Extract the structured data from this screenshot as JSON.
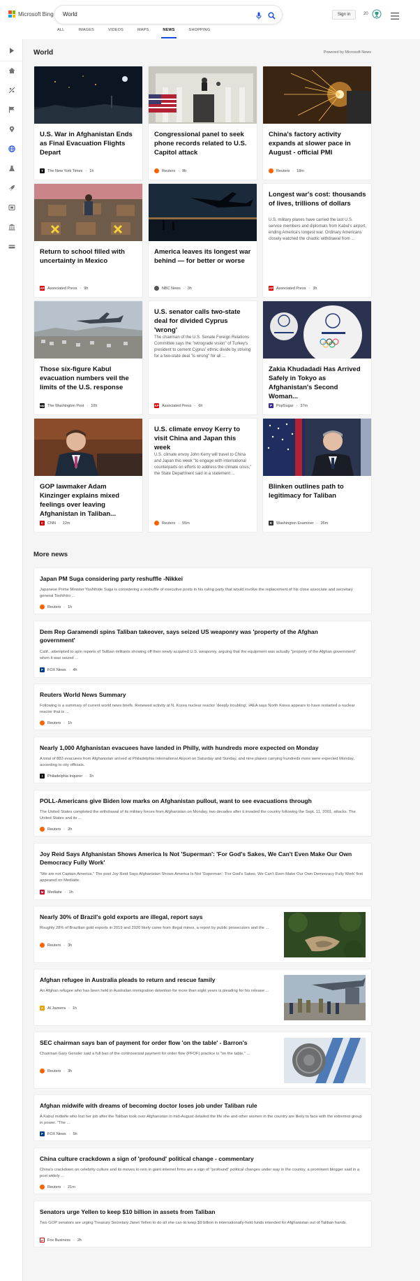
{
  "header": {
    "brand": "Microsoft Bing",
    "search_value": "World",
    "signin": "Sign in",
    "points": "20",
    "tabs": [
      {
        "label": "ALL"
      },
      {
        "label": "IMAGES"
      },
      {
        "label": "VIDEOS"
      },
      {
        "label": "MAPS"
      },
      {
        "label": "NEWS"
      },
      {
        "label": "SHOPPING"
      }
    ],
    "active_tab": "NEWS",
    "colors": {
      "accent": "#174ae4",
      "ms_red": "#f25022",
      "ms_green": "#7fba00",
      "ms_blue": "#00a4ef",
      "ms_yellow": "#ffb900"
    }
  },
  "rail": {
    "icons": [
      "expand-icon",
      "home-icon",
      "sports-icon",
      "flag-icon",
      "location-icon",
      "globe-icon",
      "science-icon",
      "rocket-icon",
      "entertainment-icon",
      "bank-icon",
      "money-icon"
    ]
  },
  "world": {
    "title": "World",
    "powered_by": "Powered by Microsoft News",
    "cards": [
      {
        "title": "U.S. War in Afghanistan Ends as Final Evacuation Flights Depart",
        "source": "The New York Times",
        "time": "1h",
        "snippet": ""
      },
      {
        "title": "Congressional panel to seek phone records related to U.S. Capitol attack",
        "source": "Reuters",
        "time": "9h",
        "snippet": ""
      },
      {
        "title": "China's factory activity expands at slower pace in August - official PMI",
        "source": "Reuters",
        "time": "18m",
        "snippet": ""
      },
      {
        "title": "Return to school filled with uncertainty in Mexico",
        "source": "Associated Press",
        "time": "9h",
        "snippet": ""
      },
      {
        "title": "America leaves its longest war behind — for better or worse",
        "source": "NBC News",
        "time": "3h",
        "snippet": ""
      },
      {
        "title": "Longest war's cost: thousands of lives, trillions of dollars",
        "source": "Associated Press",
        "time": "3h",
        "snippet": "U.S. military planes have carried the last U.S. service members and diplomats from Kabul's airport, ending America's longest war. Ordinary Americans closely watched the chaotic withdrawal from ..."
      },
      {
        "title": "Those six-figure Kabul evacuation numbers veil the limits of the U.S. response",
        "source": "The Washington Post",
        "time": "10h",
        "snippet": ""
      },
      {
        "title": "U.S. senator calls two-state deal for divided Cyprus 'wrong'",
        "source": "Associated Press",
        "time": "6h",
        "snippet": "The chairman of the U.S. Senate Foreign Relations Committee says the \"retrograde vision\" of Turkey's president to cement Cyprus' ethnic divide by striving for a two-state deal \"is wrong\" for all ..."
      },
      {
        "title": "Zakia Khudadadi Has Arrived Safely in Tokyo as Afghanistan's Second Woman...",
        "source": "PopSugar",
        "time": "37m",
        "snippet": ""
      },
      {
        "title": "GOP lawmaker Adam Kinzinger explains mixed feelings over leaving Afghanistan in Taliban...",
        "source": "CNN",
        "time": "12m",
        "snippet": ""
      },
      {
        "title": "U.S. climate envoy Kerry to visit China and Japan this week",
        "source": "Reuters",
        "time": "55m",
        "snippet": "U.S. climate envoy John Kerry will travel to China and Japan this week \"to engage with international counterparts on efforts to address the climate crisis,\" the State Department said in a statement ..."
      },
      {
        "title": "Blinken outlines path to legitimacy for Taliban",
        "source": "Washington Examiner",
        "time": "35m",
        "snippet": ""
      }
    ]
  },
  "more": {
    "title": "More news",
    "items": [
      {
        "title": "Japan PM Suga considering party reshuffle -Nikkei",
        "snippet": "Japanese Prime Minister Yoshihide Suga is considering a reshuffle of executive posts in his ruling party that would involve the replacement of his close associate and secretary general Toshihiro ...",
        "source": "Reuters",
        "time": "1h"
      },
      {
        "title": "Dem Rep Garamendi spins Taliban takeover, says seized US weaponry was 'property of the Afghan government'",
        "snippet": "Calif., attempted to spin reports of Taliban militants showing off their newly acquired U.S. weaponry, arguing that the equipment was actually \"property of the Afghan government\" when it was seized ...",
        "source": "FOX News",
        "time": "4h"
      },
      {
        "title": "Reuters World News Summary",
        "snippet": "Following is a summary of current world news briefs. Renewed activity at N. Korea nuclear reactor 'deeply troubling', IAEA says North Korea appears to have restarted a nuclear reactor that is ...",
        "source": "Reuters",
        "time": "1h"
      },
      {
        "title": "Nearly 1,000 Afghanistan evacuees have landed in Philly, with hundreds more expected on Monday",
        "snippet": "A total of 883 evacuees from Afghanistan arrived at Philadelphia International Airport on Saturday and Sunday, and nine planes carrying hundreds more were expected Monday, according to city officials.",
        "source": "Philadelphia Inquirer",
        "time": "1h"
      },
      {
        "title": "POLL-Americans give Biden low marks on Afghanistan pullout, want to see evacuations through",
        "snippet": "The United States completed the withdrawal of its military forces from Afghanistan on Monday, two decades after it invaded the country following the Sept. 11, 2001, attacks. The United States and its ...",
        "source": "Reuters",
        "time": "2h"
      },
      {
        "title": "Joy Reid Says Afghanistan Shows America Is Not 'Superman': 'For God's Sakes, We Can't Even Make Our Own Democracy Fully Work'",
        "snippet": "\"We are not Captain America.\" The post Joy Reid Says Afghanistan Shows America Is Not 'Superman': 'For God's Sakes, We Can't Even Make Our Own Democracy Fully Work' first appeared on Mediaite.",
        "source": "Mediaite",
        "time": "1h"
      },
      {
        "title": "Nearly 30% of Brazil's gold exports are illegal, report says",
        "snippet": "Roughly 28% of Brazilian gold exports in 2019 and 2020 likely came from illegal mines, a report by public prosecutors and the ...",
        "source": "Reuters",
        "time": "3h"
      },
      {
        "title": "Afghan refugee in Australia pleads to return and rescue family",
        "snippet": "An Afghan refugee who has been held in Australian immigration detention for more than eight years is pleading for his release ...",
        "source": "Al Jazeera",
        "time": "1h"
      },
      {
        "title": "SEC chairman says ban of payment for order flow 'on the table' - Barron's",
        "snippet": "Chairman Gary Gensler said a full ban of the controversial payment for order flow (PFOF) practice is \"on the table,\" ...",
        "source": "Reuters",
        "time": "3h"
      },
      {
        "title": "Afghan midwife with dreams of becoming doctor loses job under Taliban rule",
        "snippet": "A Kabul midwife who lost her job after the Taliban took over Afghanistan in mid-August detailed the life she and other women in the country are likely to face with the extremist group in power. \"The ...",
        "source": "FOX News",
        "time": "5h"
      },
      {
        "title": "China culture crackdown a sign of 'profound' political change - commentary",
        "snippet": "China's crackdown on celebrity culture and its moves to rein in giant internet firms are a sign of \"profound\" political changes under way in the country, a prominent blogger said in a post widely ...",
        "source": "Reuters",
        "time": "21m"
      },
      {
        "title": "Senators urge Yellen to keep $10 billion in assets from Taliban",
        "snippet": "Two GOP senators are urging Treasury Secretary Janet Yellen to do all she can to keep $9 billion in internationally-held funds intended for Afghanistan out of Taliban hands.",
        "source": "Fox Business",
        "time": "2h"
      }
    ]
  }
}
